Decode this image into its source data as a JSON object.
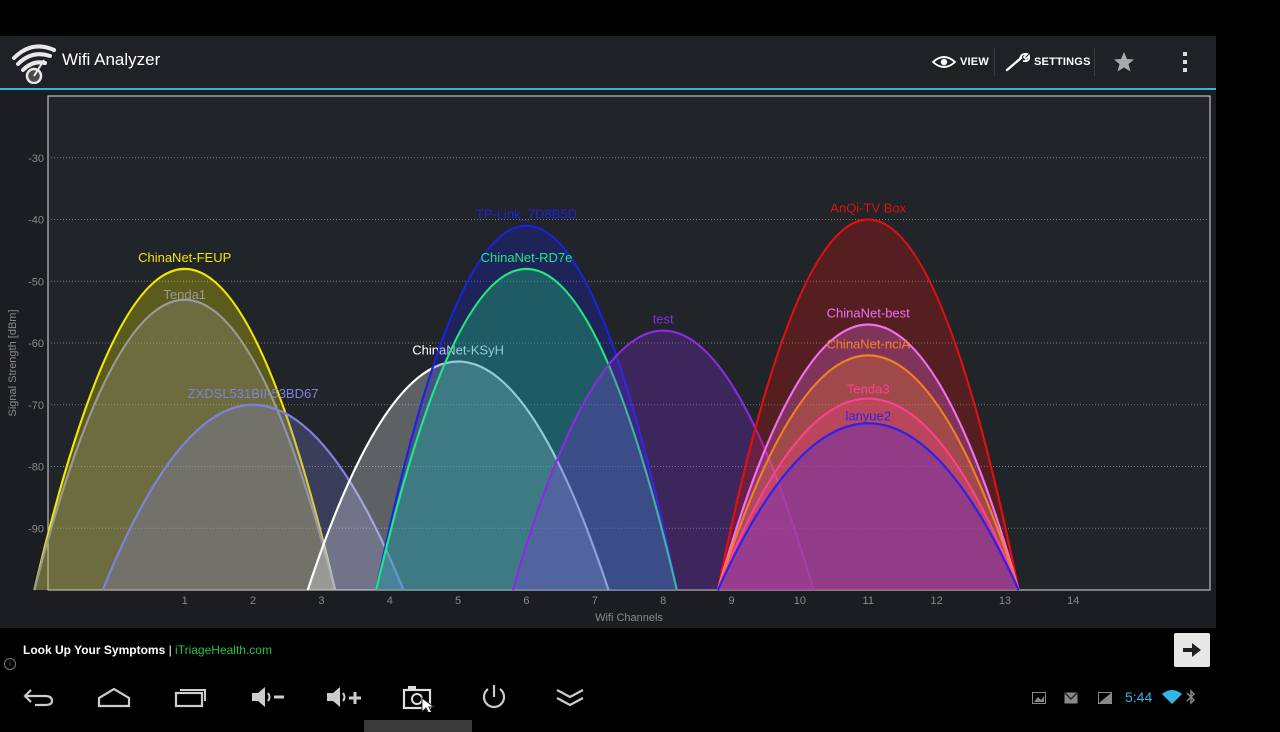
{
  "app": {
    "title": "Wifi Analyzer",
    "actions": {
      "view_label": "VIEW",
      "settings_label": "SETTINGS"
    },
    "accent_color": "#33b5e5"
  },
  "chart_data": {
    "type": "area",
    "xlabel": "Wifi Channels",
    "ylabel": "Signal Strength [dBm]",
    "xlim": [
      -1,
      16
    ],
    "ylim": [
      -100,
      -20
    ],
    "x_ticks": [
      1,
      2,
      3,
      4,
      5,
      6,
      7,
      8,
      9,
      10,
      11,
      12,
      13,
      14
    ],
    "y_ticks": [
      -30,
      -40,
      -50,
      -60,
      -70,
      -80,
      -90
    ],
    "grid": true,
    "series": [
      {
        "name": "ChinaNet-FEUP",
        "channel": 1,
        "dbm": -48,
        "color": "#f0e800"
      },
      {
        "name": "Tenda1",
        "channel": 1,
        "dbm": -53,
        "color": "#9a9a9a"
      },
      {
        "name": "ZXDSL531BII-53BD67",
        "channel": 2,
        "dbm": -70,
        "color": "#8080e0"
      },
      {
        "name": "ChinaNet-KSyH",
        "channel": 5,
        "dbm": -63,
        "color": "#ffffff"
      },
      {
        "name": "TP-Link_7D8B5D",
        "channel": 6,
        "dbm": -41,
        "color": "#1a24e0"
      },
      {
        "name": "ChinaNet-RD7e",
        "channel": 6,
        "dbm": -48,
        "color": "#22e880"
      },
      {
        "name": "test",
        "channel": 8,
        "dbm": -58,
        "color": "#8a2be2"
      },
      {
        "name": "AnQi-TV Box",
        "channel": 11,
        "dbm": -40,
        "color": "#e01010"
      },
      {
        "name": "ChinaNet-best",
        "channel": 11,
        "dbm": -57,
        "color": "#f070f0"
      },
      {
        "name": "ChinaNet-nciA",
        "channel": 11,
        "dbm": -62,
        "color": "#f08020"
      },
      {
        "name": "Tenda3",
        "channel": 11,
        "dbm": -69,
        "color": "#ff4090"
      },
      {
        "name": "lanyue2",
        "channel": 11,
        "dbm": -73,
        "color": "#3020f0"
      }
    ]
  },
  "ad": {
    "title": "Look Up Your Symptoms",
    "separator": " | ",
    "link": "iTriageHealth.com"
  },
  "status": {
    "time": "5:44"
  }
}
